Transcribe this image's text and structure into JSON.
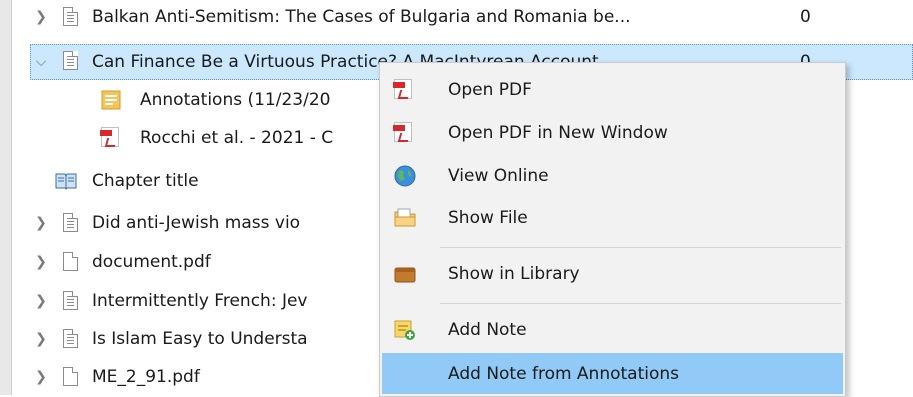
{
  "tree": {
    "rows": [
      {
        "label": "Balkan Anti-Semitism: The Cases of Bulgaria and Romania be...",
        "count": "0",
        "expanded": false
      },
      {
        "label": "Can Finance Be a Virtuous Practice? A MacIntyrean Account",
        "count": "0",
        "expanded": true
      },
      {
        "label": "Annotations (11/23/20"
      },
      {
        "label": "Rocchi et al. - 2021 - C"
      },
      {
        "label": "Chapter title"
      },
      {
        "label": "Did anti-Jewish mass vio"
      },
      {
        "label": "document.pdf"
      },
      {
        "label": "Intermittently French: Jev"
      },
      {
        "label": "Is Islam Easy to Understa"
      },
      {
        "label": "ME_2_91.pdf"
      }
    ]
  },
  "context_menu": {
    "items": [
      {
        "label": "Open PDF",
        "icon": "pdf-icon"
      },
      {
        "label": "Open PDF in New Window",
        "icon": "pdf-icon"
      },
      {
        "label": "View Online",
        "icon": "globe-icon"
      },
      {
        "label": "Show File",
        "icon": "folder-icon"
      },
      {
        "label": "Show in Library",
        "icon": "library-icon"
      },
      {
        "label": "Add Note",
        "icon": "add-note-icon"
      },
      {
        "label": "Add Note from Annotations",
        "icon": "",
        "highlighted": true
      }
    ]
  }
}
